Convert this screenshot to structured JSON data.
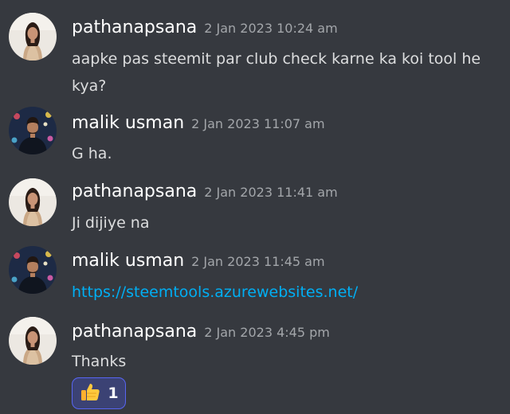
{
  "messages": [
    {
      "username": "pathanapsana",
      "timestamp": "2 Jan 2023 10:24 am",
      "text_line1": "aapke pas steemit par club check karne ka koi tool he",
      "text_line2": "kya?"
    },
    {
      "username": "malik usman",
      "timestamp": "2 Jan 2023 11:07 am",
      "text": "G ha."
    },
    {
      "username": "pathanapsana",
      "timestamp": "2 Jan 2023 11:41 am",
      "text": "Ji dijiye na"
    },
    {
      "username": "malik usman",
      "timestamp": "2 Jan 2023 11:45 am",
      "link": "https://steemtools.azurewebsites.net/"
    },
    {
      "username": "pathanapsana",
      "timestamp": "2 Jan 2023 4:45 pm",
      "text": "Thanks",
      "reaction": {
        "icon": "thumbs-up-icon",
        "count": "1"
      }
    }
  ],
  "colors": {
    "background": "#36393f",
    "username": "#ffffff",
    "timestamp": "#a3a6aa",
    "message_text": "#dcddde",
    "link": "#00aff4",
    "reaction_bg": "#3b4274",
    "reaction_border": "#5865f2"
  }
}
